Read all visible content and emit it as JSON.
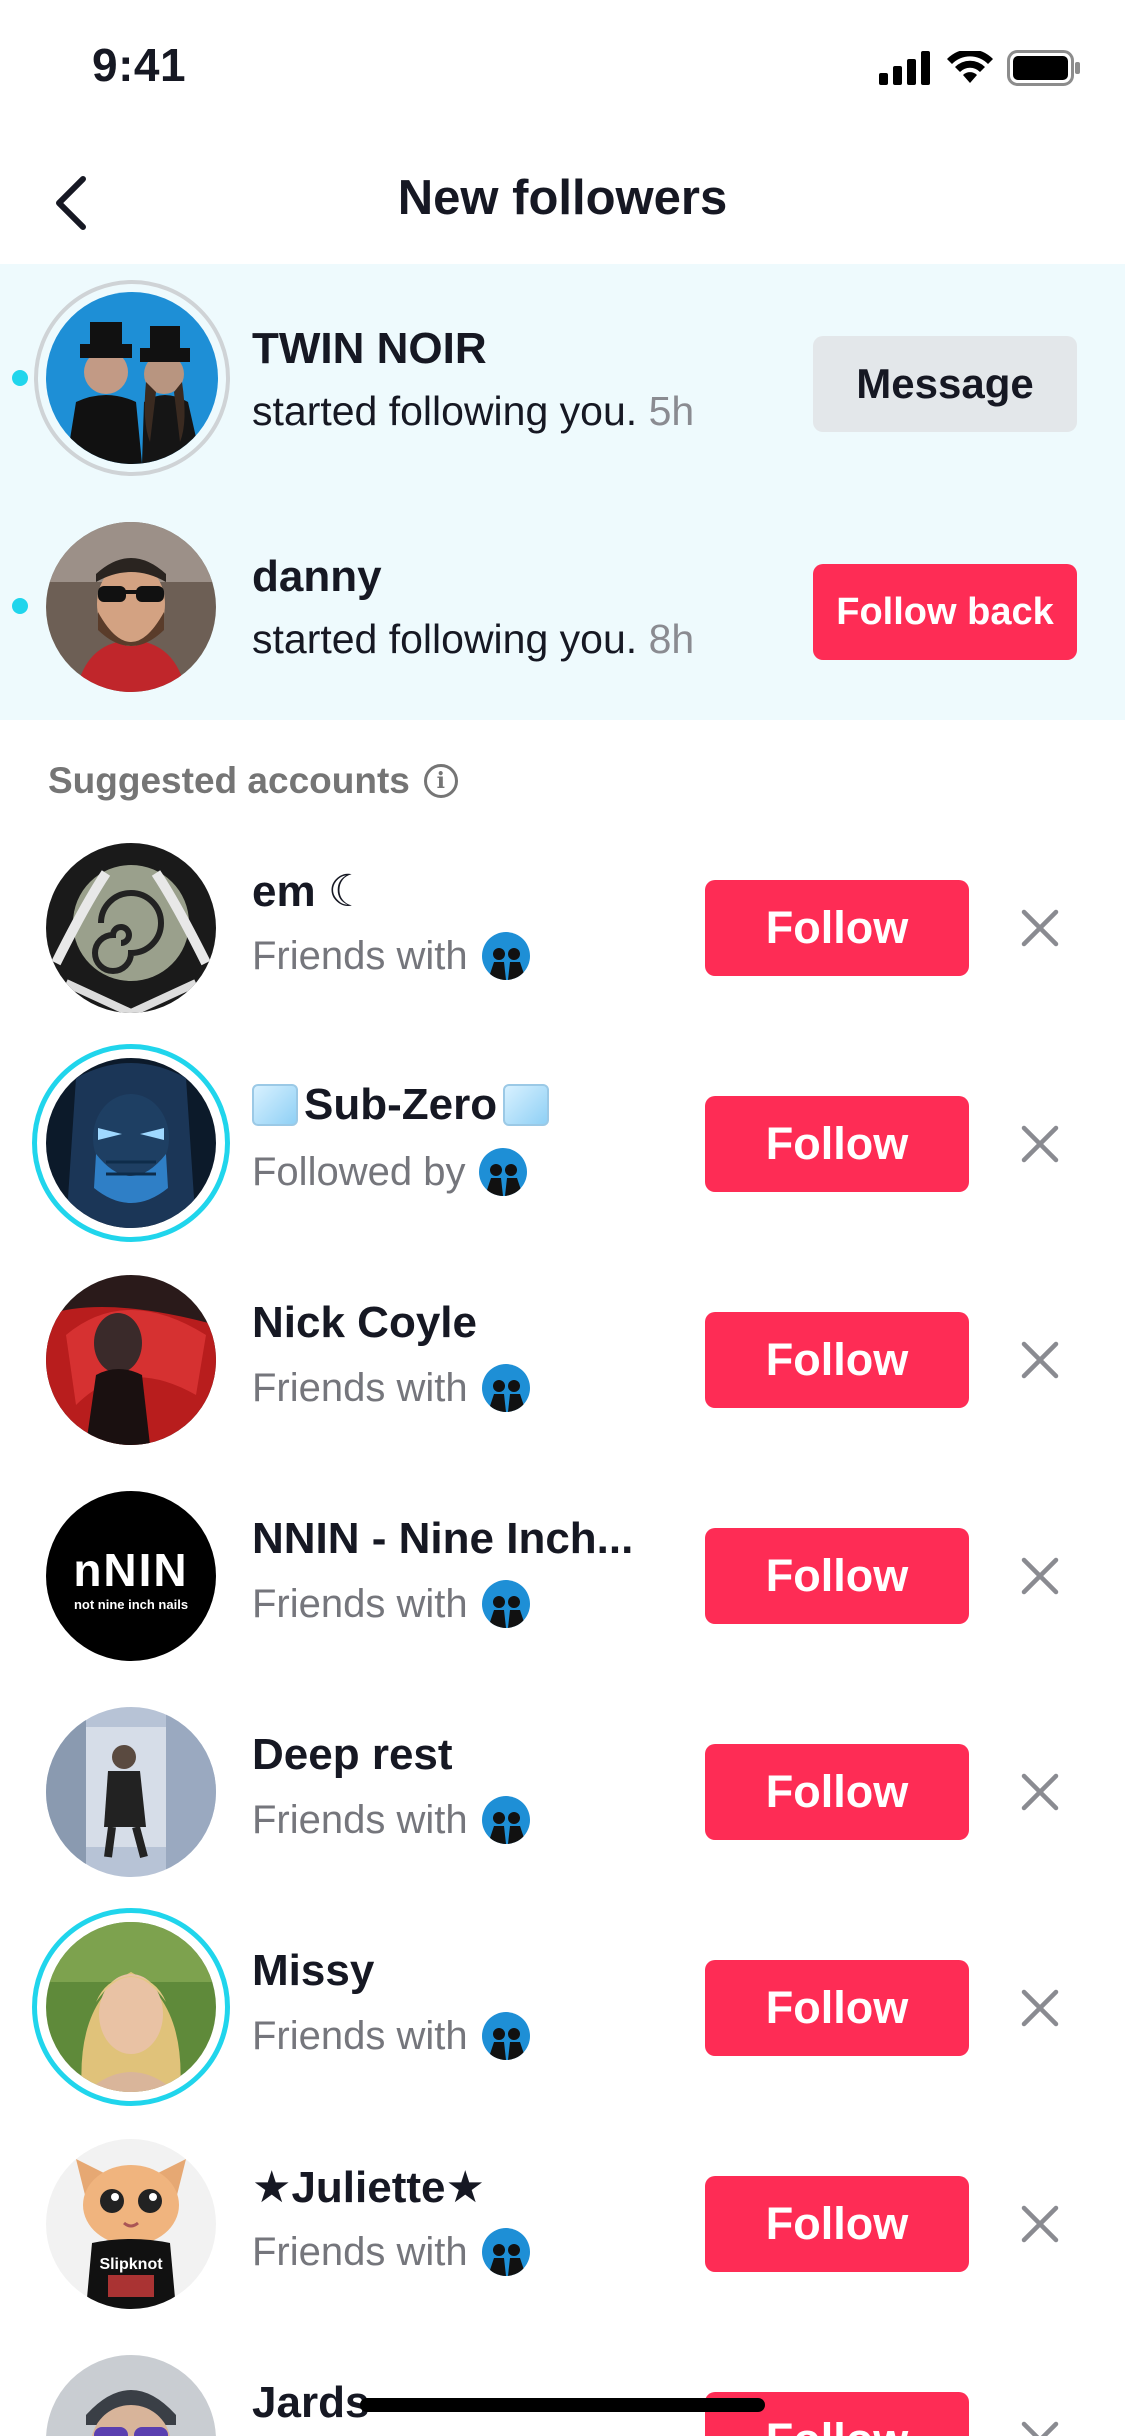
{
  "status_bar": {
    "time": "9:41"
  },
  "header": {
    "title": "New followers"
  },
  "new_followers": [
    {
      "name": "TWIN NOIR",
      "activity": "started following you.",
      "time": "5h",
      "action_label": "Message",
      "unread": true
    },
    {
      "name": "danny",
      "activity": "started following you.",
      "time": "8h",
      "action_label": "Follow back",
      "unread": true
    }
  ],
  "suggested": {
    "heading": "Suggested accounts",
    "follow_label": "Follow",
    "items": [
      {
        "name": "em ☾",
        "relation": "Friends with",
        "ring": false
      },
      {
        "name": "Sub-Zero",
        "relation": "Followed by",
        "ring": true,
        "decor": "ice-cube"
      },
      {
        "name": "Nick Coyle",
        "relation": "Friends with",
        "ring": false
      },
      {
        "name": "NNIN - Nine Inch...",
        "relation": "Friends with",
        "ring": false,
        "avatar_text": "nNIN",
        "avatar_subtext": "not nine inch nails"
      },
      {
        "name": "Deep rest",
        "relation": "Friends with",
        "ring": false
      },
      {
        "name": "Missy",
        "relation": "Friends with",
        "ring": true
      },
      {
        "name": "★Juliette★",
        "relation": "Friends with",
        "ring": false
      },
      {
        "name": "Jards",
        "relation": "",
        "ring": false
      }
    ]
  },
  "colors": {
    "accent": "#fe2c55",
    "ring": "#20d5ec",
    "highlight_bg": "#eefafd"
  }
}
